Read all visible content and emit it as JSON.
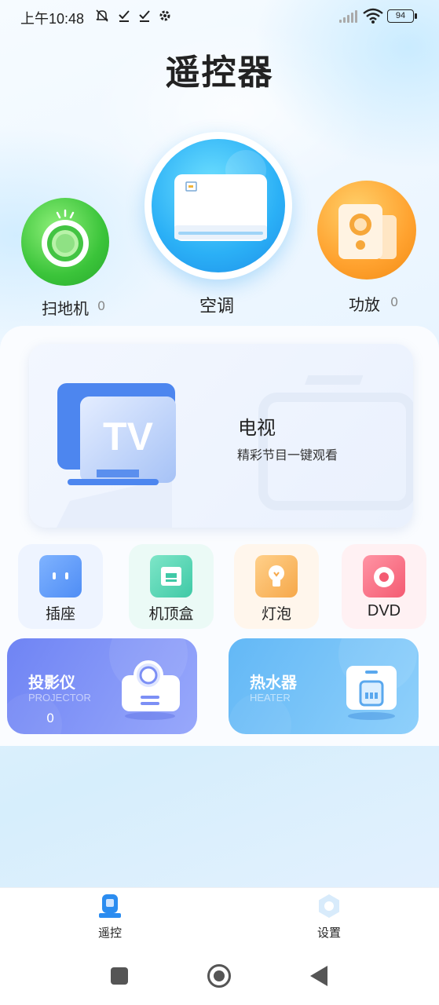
{
  "status": {
    "time": "上午10:48",
    "battery": "94"
  },
  "header": {
    "title": "遥控器"
  },
  "featured_devices": [
    {
      "label": "扫地机",
      "count": "0"
    },
    {
      "label": "空调",
      "count": ""
    },
    {
      "label": "功放",
      "count": "0"
    }
  ],
  "tv_card": {
    "icon_text": "TV",
    "title": "电视",
    "subtitle": "精彩节目一键观看"
  },
  "small_devices": [
    {
      "label": "插座"
    },
    {
      "label": "机顶盒"
    },
    {
      "label": "灯泡"
    },
    {
      "label": "DVD"
    }
  ],
  "large_devices": [
    {
      "title": "投影仪",
      "subtitle": "PROJECTOR",
      "count": "0"
    },
    {
      "title": "热水器",
      "subtitle": "HEATER",
      "count": ""
    }
  ],
  "bottom_nav": [
    {
      "label": "遥控",
      "active": true
    },
    {
      "label": "设置",
      "active": false
    }
  ],
  "colors": {
    "accent_blue": "#2b8cf0",
    "sweeper_green": "#3bc43a",
    "ac_blue": "#2bb0f6",
    "amp_orange": "#ffa22f",
    "projector_purple": "#7d8ff7",
    "heater_blue": "#76c4f7"
  }
}
